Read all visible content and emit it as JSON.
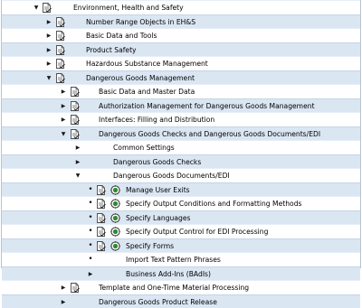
{
  "colors": {
    "row_alt": "#dbe6f3",
    "row_base": "#ffffff",
    "icon_doc": "#4a4a4a",
    "icon_exec": "#2e8b2e"
  },
  "rows": [
    {
      "label": "Environment, Health and Safety",
      "bullet": "expanded",
      "doc": true,
      "exec": false,
      "name": "ehs"
    },
    {
      "label": "Number Range Objects in EH&S",
      "bullet": "collapsed",
      "doc": true,
      "exec": false,
      "name": "number-range"
    },
    {
      "label": "Basic Data and Tools",
      "bullet": "collapsed",
      "doc": true,
      "exec": false,
      "name": "basic-data-tools"
    },
    {
      "label": "Product Safety",
      "bullet": "collapsed",
      "doc": true,
      "exec": false,
      "name": "product-safety"
    },
    {
      "label": "Hazardous Substance Management",
      "bullet": "collapsed",
      "doc": true,
      "exec": false,
      "name": "hazardous-substance"
    },
    {
      "label": "Dangerous Goods Management",
      "bullet": "expanded",
      "doc": true,
      "exec": false,
      "name": "dg-management"
    },
    {
      "label": "Basic Data and Master Data",
      "bullet": "collapsed",
      "doc": true,
      "exec": false,
      "name": "basic-master-data"
    },
    {
      "label": "Authorization Management for Dangerous Goods Management",
      "bullet": "collapsed",
      "doc": true,
      "exec": false,
      "name": "authorization-mgmt"
    },
    {
      "label": "Interfaces: Filling and Distribution",
      "bullet": "collapsed",
      "doc": true,
      "exec": false,
      "name": "interfaces"
    },
    {
      "label": "Dangerous Goods Checks and Dangerous Goods Documents/EDI",
      "bullet": "expanded",
      "doc": true,
      "exec": false,
      "name": "dg-checks-docs"
    },
    {
      "label": "Common Settings",
      "bullet": "collapsed",
      "doc": false,
      "exec": false,
      "name": "common-settings"
    },
    {
      "label": "Dangerous Goods Checks",
      "bullet": "collapsed",
      "doc": false,
      "exec": false,
      "name": "dg-checks"
    },
    {
      "label": "Dangerous Goods Documents/EDI",
      "bullet": "expanded",
      "doc": false,
      "exec": false,
      "name": "dg-documents"
    },
    {
      "label": "Manage User Exits",
      "bullet": "dot",
      "doc": true,
      "exec": true,
      "name": "manage-user-exits"
    },
    {
      "label": "Specify Output Conditions and Formatting Methods",
      "bullet": "dot",
      "doc": true,
      "exec": true,
      "name": "output-conditions"
    },
    {
      "label": "Specify Languages",
      "bullet": "dot",
      "doc": true,
      "exec": true,
      "name": "specify-languages"
    },
    {
      "label": "Specify Output Control for EDI Processing",
      "bullet": "dot",
      "doc": true,
      "exec": true,
      "name": "output-control-edi"
    },
    {
      "label": "Specify Forms",
      "bullet": "dot",
      "doc": true,
      "exec": true,
      "name": "specify-forms"
    },
    {
      "label": "Import Text Pattern Phrases",
      "bullet": "dot",
      "doc": false,
      "exec": false,
      "name": "import-text-pattern"
    },
    {
      "label": "Business Add-Ins (BAdIs)",
      "bullet": "collapsed",
      "doc": false,
      "exec": false,
      "name": "business-add-ins"
    },
    {
      "label": "Template and One-Time Material Processing",
      "bullet": "collapsed",
      "doc": true,
      "exec": false,
      "name": "template-material"
    },
    {
      "label": "Dangerous Goods Product Release",
      "bullet": "collapsed",
      "doc": false,
      "exec": false,
      "name": "dg-product-release"
    }
  ]
}
